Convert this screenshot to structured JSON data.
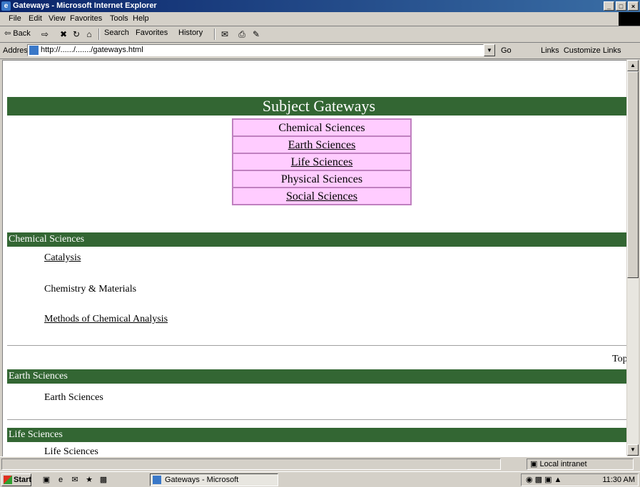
{
  "window": {
    "title": "Gateways - Microsoft Internet Explorer",
    "min": "_",
    "max": "□",
    "close": "×"
  },
  "menu": [
    "File",
    "Edit",
    "View",
    "Favorites",
    "Tools",
    "Help"
  ],
  "toolbar": {
    "back": "⇦ Back",
    "forward": "⇨",
    "stop": "✖",
    "refresh": "↻",
    "home": "⌂",
    "search": "Search",
    "favorites": "Favorites",
    "history": "History",
    "mail": "✉",
    "print": "⎙",
    "edit": "✎"
  },
  "address": {
    "label": "Address",
    "url": "http://....../......./gateways.html",
    "go": "Go",
    "links": "Links",
    "links_extra": "Customize Links"
  },
  "page": {
    "banner": "Subject Gateways",
    "nav": [
      {
        "label": "Chemical Sciences",
        "link": false
      },
      {
        "label": "Earth Sciences",
        "link": true
      },
      {
        "label": "Life Sciences",
        "link": true
      },
      {
        "label": "Physical Sciences",
        "link": false
      },
      {
        "label": "Social Sciences",
        "link": true
      }
    ],
    "sections": [
      {
        "title": "Chemical Sciences",
        "items": [
          "Catalysis",
          "Chemistry & Materials",
          "Methods of Chemical Analysis"
        ]
      },
      {
        "title": "Earth Sciences",
        "items": [
          "Earth Sciences"
        ]
      },
      {
        "title": "Life Sciences",
        "items": [
          "Life Sciences"
        ]
      }
    ],
    "top_link": "Top"
  },
  "status": {
    "left": "",
    "zone": "Local intranet"
  },
  "taskbar": {
    "start": "Start",
    "task": "Gateways - Microsoft",
    "clock": "11:30 AM"
  }
}
